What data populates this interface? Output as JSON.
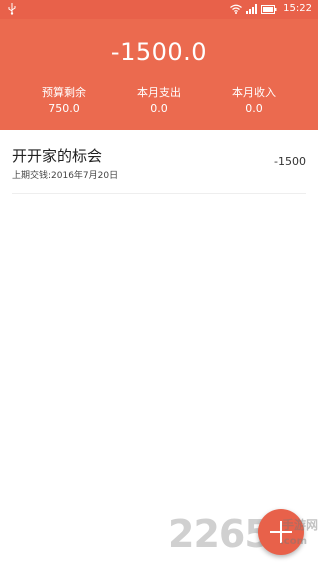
{
  "statusbar": {
    "time": "15:22",
    "usb_icon": "usb-icon",
    "wifi_icon": "wifi-icon",
    "signal_icon": "signal-icon",
    "battery_icon": "battery-icon"
  },
  "header": {
    "balance": "-1500.0",
    "stats": [
      {
        "label": "预算剩余",
        "value": "750.0"
      },
      {
        "label": "本月支出",
        "value": "0.0"
      },
      {
        "label": "本月收入",
        "value": "0.0"
      }
    ]
  },
  "list": [
    {
      "title": "开开家的标会",
      "subtitle": "上期交钱:2016年7月20日",
      "amount": "-1500"
    }
  ],
  "fab": {
    "icon": "plus-icon"
  },
  "watermark": {
    "number": "2265",
    "cn": "手游网",
    "domain": ".com"
  },
  "colors": {
    "accent": "#eb6a4f",
    "statusbar": "#e8614a"
  }
}
